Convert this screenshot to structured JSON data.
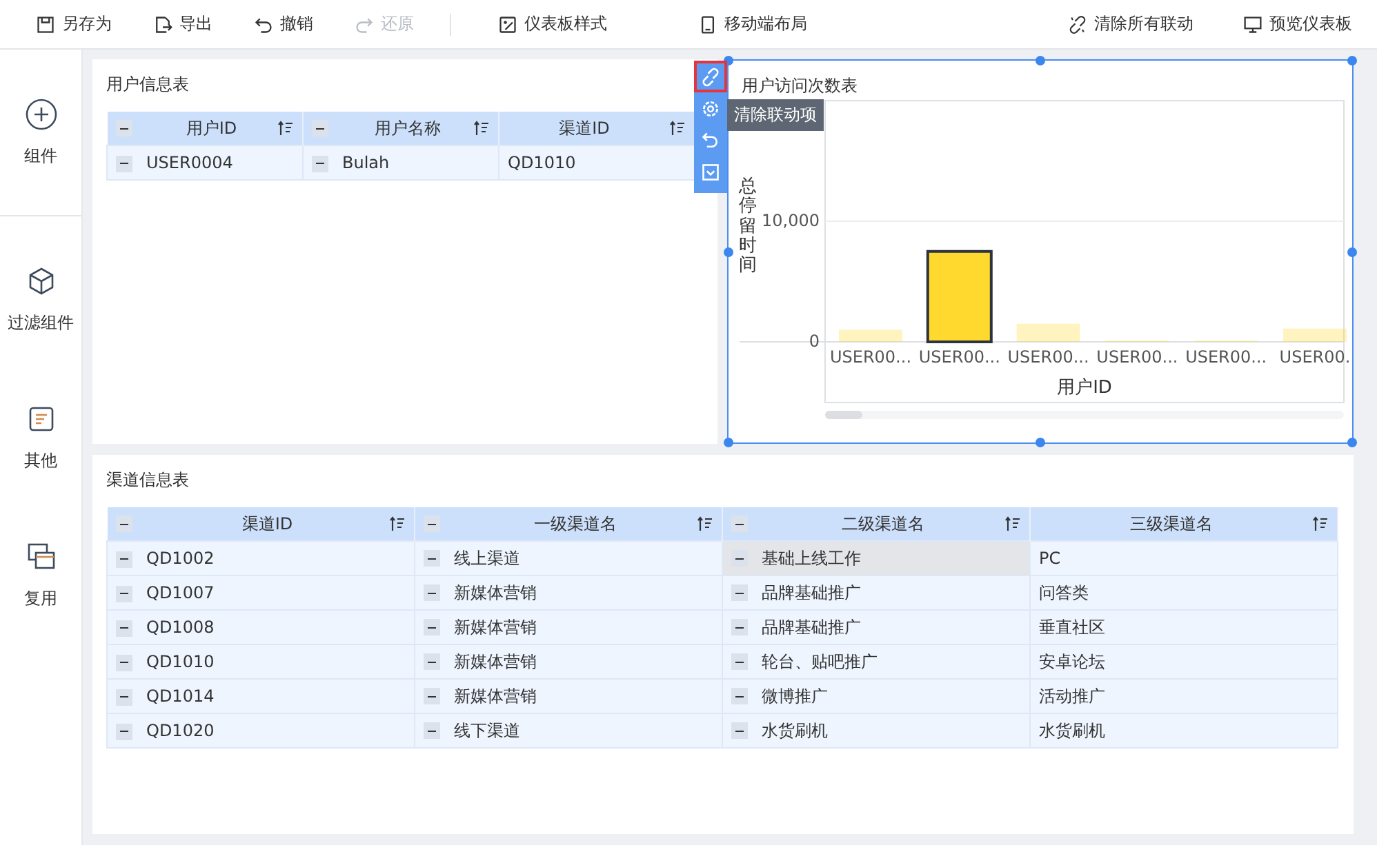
{
  "toolbar": {
    "left": [
      {
        "label": "另存为",
        "disabled": false
      },
      {
        "label": "导出",
        "disabled": false
      },
      {
        "label": "撤销",
        "disabled": false
      },
      {
        "label": "还原",
        "disabled": true
      }
    ],
    "middle": [
      {
        "label": "仪表板样式"
      },
      {
        "label": "移动端布局"
      }
    ],
    "right": [
      {
        "label": "清除所有联动"
      },
      {
        "label": "预览仪表板"
      }
    ]
  },
  "sidebar": {
    "items": [
      {
        "label": "组件"
      },
      {
        "label": "过滤组件"
      },
      {
        "label": "其他"
      },
      {
        "label": "复用"
      }
    ]
  },
  "user_table": {
    "title": "用户信息表",
    "columns": [
      {
        "label": "用户ID",
        "collapsible": true
      },
      {
        "label": "用户名称",
        "collapsible": true
      },
      {
        "label": "渠道ID",
        "collapsible": false
      }
    ],
    "rows": [
      [
        {
          "text": "USER0004",
          "collapsible": true
        },
        {
          "text": "Bulah",
          "collapsible": true
        },
        {
          "text": "QD1010",
          "collapsible": false
        }
      ]
    ]
  },
  "chart_widget": {
    "title": "用户访问次数表",
    "selected": true,
    "tooltip": "清除联动项",
    "bar_states": [
      {
        "selected": false
      },
      {
        "selected": true
      },
      {
        "selected": false
      },
      {
        "selected": false
      },
      {
        "selected": false
      },
      {
        "selected": false
      }
    ],
    "chart_data": {
      "type": "bar",
      "xlabel": "用户ID",
      "ylabel": "总停留时间",
      "categories": [
        "USER00...",
        "USER00...",
        "USER00...",
        "USER00...",
        "USER00...",
        "USER00."
      ],
      "series": [
        {
          "color": "#ffd92e",
          "values": [
            1000,
            7500,
            1500,
            100,
            100,
            1100
          ]
        }
      ],
      "ylim": [
        0,
        20000
      ],
      "yticks": [
        {
          "value": 0,
          "label": "0"
        },
        {
          "value": 10000,
          "label": "10,000"
        }
      ]
    }
  },
  "channel_table": {
    "title": "渠道信息表",
    "columns": [
      {
        "label": "渠道ID",
        "collapsible": true
      },
      {
        "label": "一级渠道名",
        "collapsible": true
      },
      {
        "label": "二级渠道名",
        "collapsible": true
      },
      {
        "label": "三级渠道名",
        "collapsible": false
      }
    ],
    "rows": [
      [
        {
          "text": "QD1002",
          "collapsible": true,
          "selected": false
        },
        {
          "text": "线上渠道",
          "collapsible": true,
          "selected": false
        },
        {
          "text": "基础上线工作",
          "collapsible": true,
          "selected": true
        },
        {
          "text": "PC",
          "collapsible": false,
          "selected": false
        }
      ],
      [
        {
          "text": "QD1007",
          "collapsible": true,
          "selected": false
        },
        {
          "text": "新媒体营销",
          "collapsible": true,
          "selected": false
        },
        {
          "text": "品牌基础推广",
          "collapsible": true,
          "selected": false
        },
        {
          "text": "问答类",
          "collapsible": false,
          "selected": false
        }
      ],
      [
        {
          "text": "QD1008",
          "collapsible": true,
          "selected": false
        },
        {
          "text": "新媒体营销",
          "collapsible": true,
          "selected": false
        },
        {
          "text": "品牌基础推广",
          "collapsible": true,
          "selected": false
        },
        {
          "text": "垂直社区",
          "collapsible": false,
          "selected": false
        }
      ],
      [
        {
          "text": "QD1010",
          "collapsible": true,
          "selected": false
        },
        {
          "text": "新媒体营销",
          "collapsible": true,
          "selected": false
        },
        {
          "text": "轮台、贴吧推广",
          "collapsible": true,
          "selected": false
        },
        {
          "text": "安卓论坛",
          "collapsible": false,
          "selected": false
        }
      ],
      [
        {
          "text": "QD1014",
          "collapsible": true,
          "selected": false
        },
        {
          "text": "新媒体营销",
          "collapsible": true,
          "selected": false
        },
        {
          "text": "微博推广",
          "collapsible": true,
          "selected": false
        },
        {
          "text": "活动推广",
          "collapsible": false,
          "selected": false
        }
      ],
      [
        {
          "text": "QD1020",
          "collapsible": true,
          "selected": false
        },
        {
          "text": "线下渠道",
          "collapsible": true,
          "selected": false
        },
        {
          "text": "水货刷机",
          "collapsible": true,
          "selected": false
        },
        {
          "text": "水货刷机",
          "collapsible": false,
          "selected": false
        }
      ]
    ]
  }
}
